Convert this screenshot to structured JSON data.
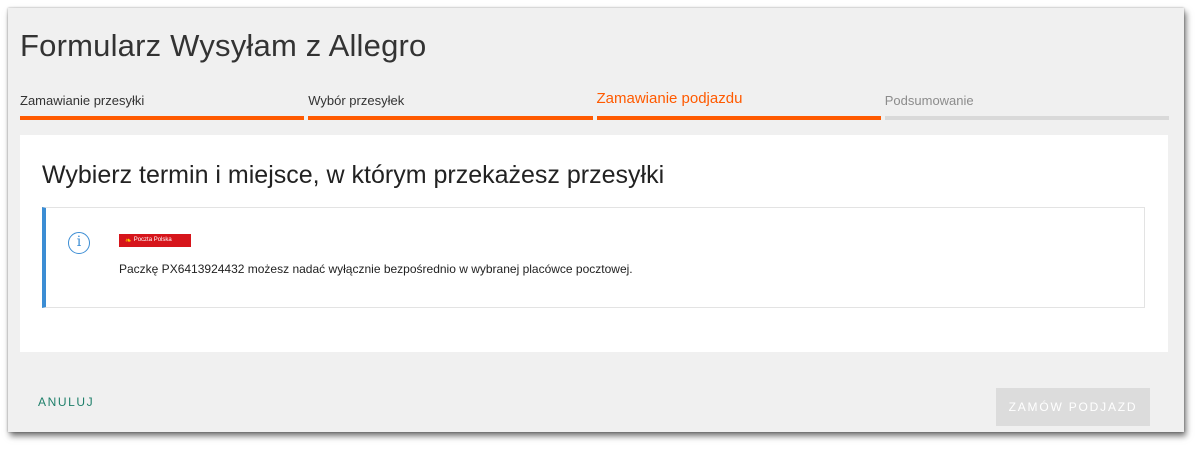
{
  "page": {
    "title": "Formularz Wysyłam z Allegro"
  },
  "steps": [
    {
      "label": "Zamawianie przesyłki",
      "state": "done"
    },
    {
      "label": "Wybór przesyłek",
      "state": "done"
    },
    {
      "label": "Zamawianie podjazdu",
      "state": "active"
    },
    {
      "label": "Podsumowanie",
      "state": "pending"
    }
  ],
  "card": {
    "heading": "Wybierz termin i miejsce, w którym przekażesz przesyłki"
  },
  "info": {
    "icon": "info-icon",
    "icon_glyph": "i",
    "carrier_logo_text": "Poczta Polska",
    "message": "Paczkę PX6413924432 możesz nadać wyłącznie bezpośrednio w wybranej placówce pocztowej."
  },
  "footer": {
    "cancel_label": "ANULUJ",
    "order_label": "ZAMÓW PODJAZD",
    "order_enabled": false
  },
  "colors": {
    "accent": "#ff5a00",
    "info_blue": "#3b8dd4",
    "cancel_green": "#1e7f6a",
    "poczta_red": "#d6151b"
  }
}
